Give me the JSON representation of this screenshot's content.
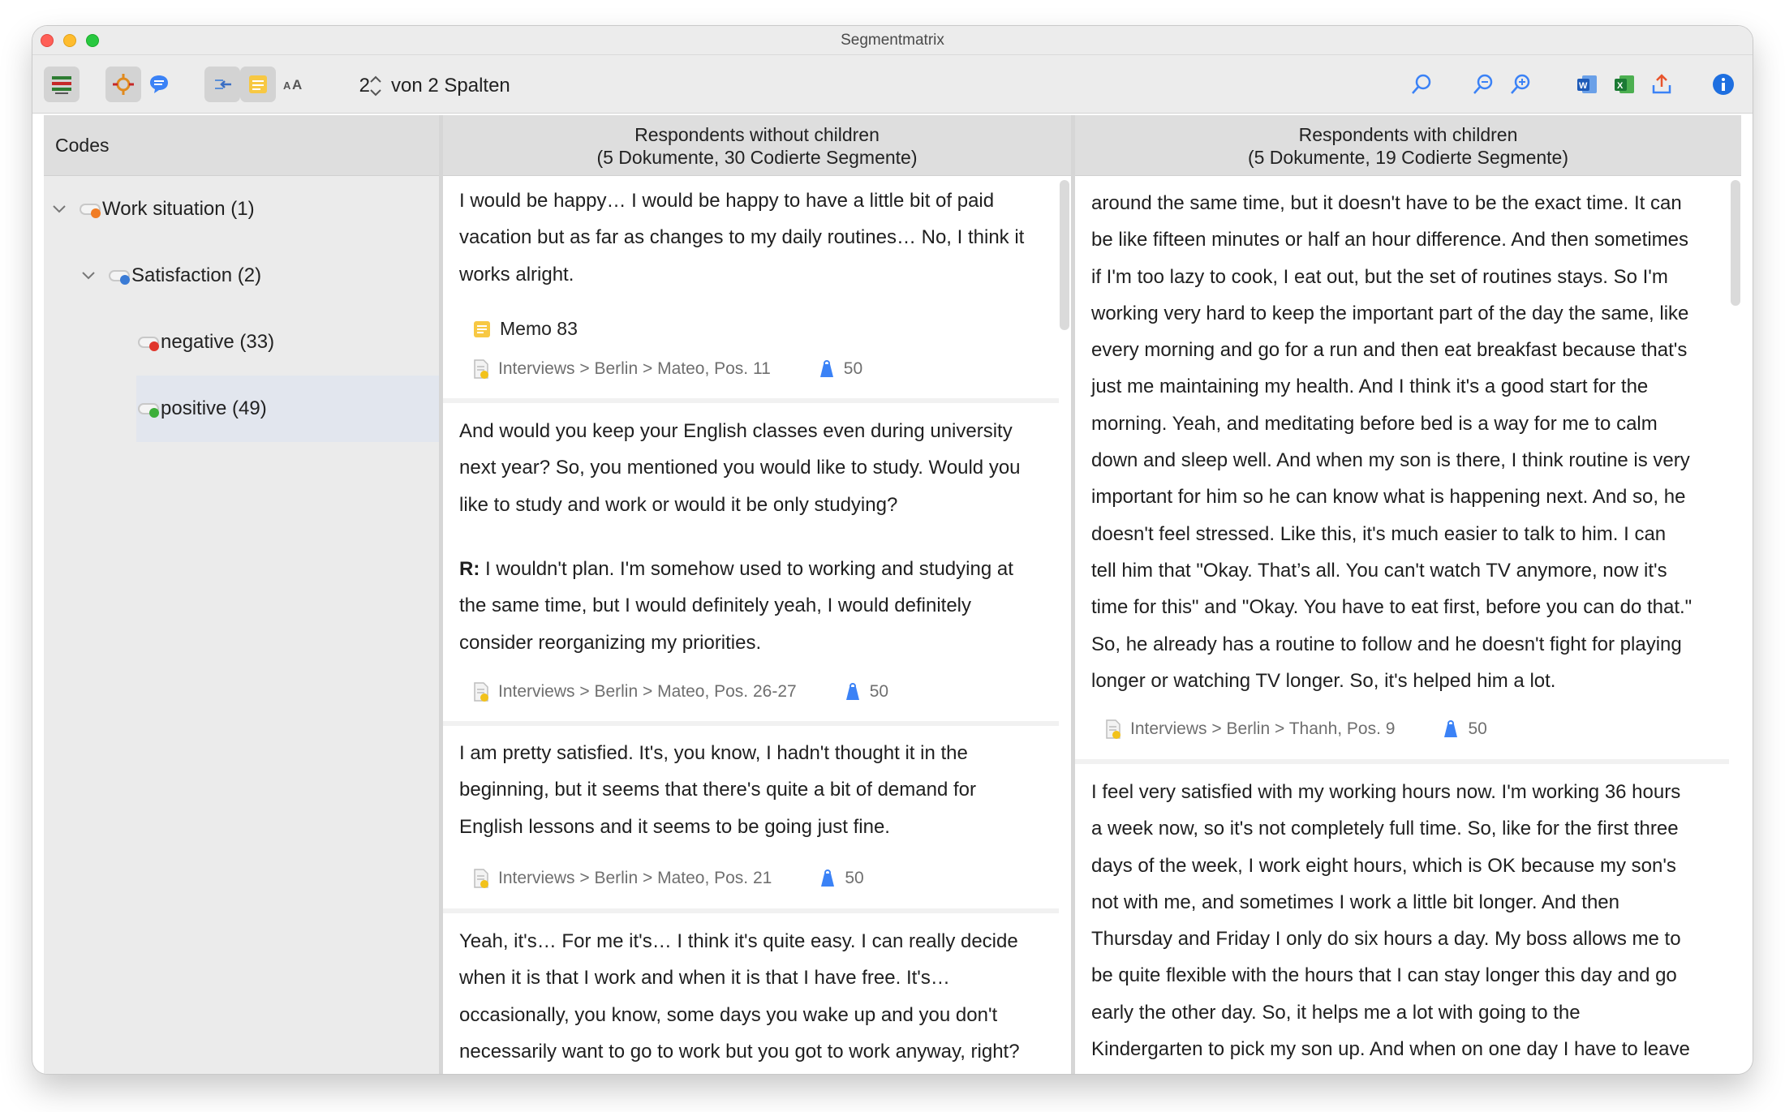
{
  "window": {
    "title": "Segmentmatrix"
  },
  "toolbar": {
    "columns_value": "2",
    "columns_label": "von 2 Spalten"
  },
  "codes": {
    "header": "Codes",
    "items": [
      {
        "label": "Work situation (1)",
        "color": "#f07c24"
      },
      {
        "label": "Satisfaction (2)",
        "color": "#3a7bd5"
      },
      {
        "label": "negative (33)",
        "color": "#e0362c"
      },
      {
        "label": "positive (49)",
        "color": "#3cae3a"
      }
    ]
  },
  "columns": [
    {
      "header_line1": "Respondents without children",
      "header_line2": "(5 Dokumente, 30 Codierte Segmente)",
      "segments": [
        {
          "lines": [
            "I would be happy… I would be happy to have a little bit of paid",
            "vacation but as far as changes to my daily routines… No, I think it",
            "works alright."
          ],
          "memo": "Memo 83",
          "source": "Interviews > Berlin > Mateo, Pos. 11",
          "weight": "50"
        },
        {
          "lines": [
            "And would you keep your English classes even during university",
            "next year? So, you mentioned you would like to study. Would you",
            "like to study and work or would it be only studying?"
          ],
          "speaker": "R:",
          "lines2": [
            " I wouldn't plan. I'm somehow used to working and studying at",
            "the same time, but I would definitely yeah, I would definitely",
            "consider reorganizing my priorities."
          ],
          "source": "Interviews > Berlin > Mateo, Pos. 26-27",
          "weight": "50"
        },
        {
          "lines": [
            "I am pretty satisfied. It's, you know, I hadn't thought it in the",
            "beginning, but it seems that there's quite a bit of demand for",
            "English lessons and it seems to be going just fine."
          ],
          "source": "Interviews > Berlin > Mateo, Pos. 21",
          "weight": "50"
        },
        {
          "lines": [
            "Yeah, it's… For me it's… I think it's quite easy. I can really decide",
            "when it is that I work and when it is that I have free. It's…",
            "occasionally, you know, some days you wake up and you don't",
            "necessarily want to go to work but you got to work anyway, right?"
          ]
        }
      ]
    },
    {
      "header_line1": "Respondents with children",
      "header_line2": "(5 Dokumente, 19 Codierte Segmente)",
      "segments": [
        {
          "lines": [
            "around the same time, but it doesn't have to be the exact time. It can",
            "be like fifteen minutes or half an hour difference. And then sometimes",
            "if I'm too lazy to cook, I eat out, but the set of routines stays. So I'm",
            "working very hard to keep the important part of the day the same, like",
            "every morning and go for a run and then eat breakfast because that's",
            "just me maintaining my health. And I think it's a good start for the",
            "morning. Yeah, and meditating before bed is a way for me to calm",
            "down and sleep well. And when my son is there, I think routine is very",
            "important for him so he can know what is happening next. And so, he",
            "doesn't feel stressed. Like this, it's much easier to talk to him. I can",
            "tell him that \"Okay. That’s all. You can't watch TV anymore, now it's",
            "time for this\" and \"Okay. You have to eat first, before you can do that.\"",
            "So, he already has a routine to follow and he doesn't fight for playing",
            "longer or watching TV longer. So, it's helped him a lot."
          ],
          "source": "Interviews > Berlin > Thanh, Pos. 9",
          "weight": "50"
        },
        {
          "lines": [
            "I feel very satisfied with my working hours now. I'm working 36 hours",
            "a week now, so it's not completely full time. So, like for the first three",
            "days of the week, I work eight hours, which is OK because my son's",
            "not with me, and sometimes I work a little bit longer. And then",
            "Thursday and Friday I only do six hours a day. My boss allows me to",
            "be quite flexible with the hours that I can stay longer this day and go",
            "early the other day. So, it helps me a lot with going to the",
            "Kindergarten to pick my son up. And when on one day I have to leave"
          ]
        }
      ]
    }
  ]
}
